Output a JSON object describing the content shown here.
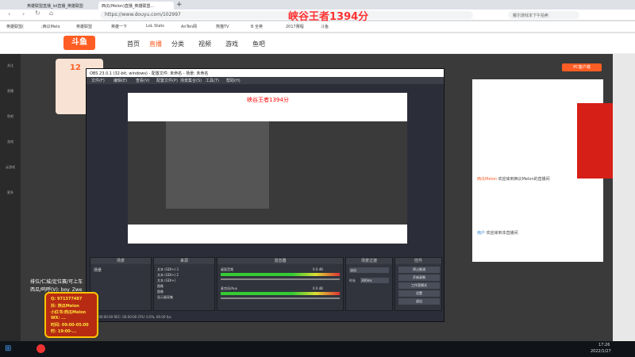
{
  "browser": {
    "tabs": [
      {
        "label": "英雄联盟直播_lol直播_英雄联盟"
      },
      {
        "label": "西瓜(Melon)直播_英雄联盟..."
      }
    ],
    "new_tab": "+",
    "url": "https://www.douyu.com/102997",
    "search_placeholder": "戴尔游戏本下午拍卖",
    "bookmarks": [
      "英雄联盟(",
      ";西瓜Melo",
      "英雄联盟",
      "英雄一下",
      "LoL Stats",
      "AnTen网",
      "熊猫TV",
      "B 全英 ",
      "2017赛程",
      "斗鱼 "
    ]
  },
  "overlay_title": "峡谷王者1394分",
  "douyu": {
    "logo": "斗鱼",
    "nav": [
      "首页",
      "直播",
      "分类",
      "视频",
      "游戏",
      "鱼吧"
    ],
    "sidebar": [
      "关注",
      "直播",
      "鱼吧",
      "游戏",
      "云游戏",
      "更多"
    ],
    "rank_number": "12",
    "chat": [
      {
        "user": "西瓜Melon",
        "text": "欢迎来到西瓜Melon的直播间"
      },
      {
        "user": "用户",
        "text": "欢迎来到本直播间"
      }
    ],
    "pc_client": "PC客户端"
  },
  "obs": {
    "title": "OBS 23.0.1 (32-bit, windows) - 配置文件: 未命名 - 场景: 未命名",
    "menu": [
      "文件(F)",
      "编辑(E)",
      "查看(V)",
      "配置文件(P)",
      "场景集合(S)",
      "工具(T)",
      "帮助(H)"
    ],
    "docks": {
      "scenes": {
        "header": "场景",
        "item": "场景"
      },
      "sources": {
        "header": "来源",
        "items": [
          "文本 (GDI+) 3",
          "文本 (GDI+) 2",
          "文本 (GDI+)",
          "图像",
          "图像",
          "显示器采集"
        ]
      },
      "mixer": {
        "header": "混音器",
        "tracks": [
          "桌面音频",
          "麦克风/Aux"
        ],
        "levels": [
          "0.0 dB",
          "0.0 dB"
        ]
      },
      "transitions": {
        "header": "场景过渡",
        "type": "淡出",
        "duration_label": "时长",
        "duration": "300ms"
      },
      "controls": {
        "header": "控件",
        "buttons": [
          "停止推流",
          "开始录制",
          "工作室模式",
          "设置",
          "退出"
        ]
      }
    },
    "status": "LIVE: 00:00:00   REC: 00:00:00   CPU: 0.0%, 60.00 fps",
    "preview_title": "峡谷王者1394分"
  },
  "overlay": {
    "lines": [
      "排位/仁城/定位赛/可上车",
      "西瓜/呜呼(V): boy_Zwe"
    ],
    "card": [
      "Q: 971377487",
      "抖: 西瓜Melon",
      "小红书:西瓜Melon",
      "WX: ...",
      "时间: 09:00-05:00",
      "时: 19:00-..."
    ]
  },
  "taskbar": {
    "time": "17:26",
    "date": "2022/1/27"
  },
  "colors": {
    "accent": "#ff5d23",
    "title_red": "#ff3333",
    "obs_bg": "#2b2e38"
  }
}
